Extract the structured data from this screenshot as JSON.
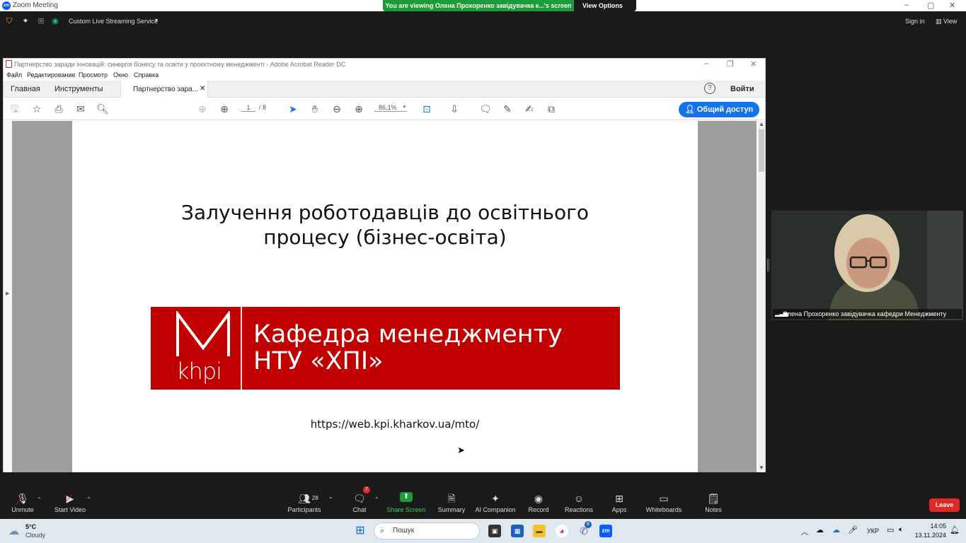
{
  "zoom": {
    "window_title": "Zoom Meeting",
    "viewing_banner": "You are viewing Олена Прохоренко завідувачка к...'s screen",
    "view_options": "View Options",
    "streaming_service": "Custom Live Streaming Service",
    "sign_in": "Sign in",
    "view": "View"
  },
  "acrobat": {
    "window_title": "Партнерство заради інновацій: синергія бізнесу та освіти у проєктному менеджменті - Adobe Acrobat Reader DC",
    "menu": [
      "Файл",
      "Редактирование",
      "Просмотр",
      "Окно",
      "Справка"
    ],
    "tabs": {
      "home": "Главная",
      "tools": "Инструменты",
      "document": "Партнерство зара..."
    },
    "signin": "Войти",
    "page_current": "1",
    "page_total": "/ 8",
    "zoom_level": "86,1%",
    "share_button": "Общий доступ"
  },
  "slide": {
    "title_line1": "Залучення роботодавців до освітнього",
    "title_line2": "процесу (бізнес-освіта)",
    "logo_text": "khpi",
    "banner_line1": "Кафедра менеджменту",
    "banner_line2": "НТУ «ХПІ»",
    "url": "https://web.kpi.kharkov.ua/mto/",
    "banner_color": "#c00000"
  },
  "participant": {
    "name": "Олена Прохоренко завідувачка кафедри Менеджменту"
  },
  "bottom_toolbar": {
    "unmute": "Unmute",
    "start_video": "Start Video",
    "participants": "Participants",
    "participants_count": "28",
    "chat": "Chat",
    "chat_badge": "7",
    "share_screen": "Share Screen",
    "summary": "Summary",
    "ai_companion": "AI Companion",
    "record": "Record",
    "reactions": "Reactions",
    "apps": "Apps",
    "whiteboards": "Whiteboards",
    "notes": "Notes",
    "leave": "Leave"
  },
  "taskbar": {
    "weather_temp": "5°C",
    "weather_desc": "Cloudy",
    "search": "Пошук",
    "lang": "УКР",
    "time": "14:05",
    "date": "13.11.2024",
    "viber_badge": "8"
  }
}
